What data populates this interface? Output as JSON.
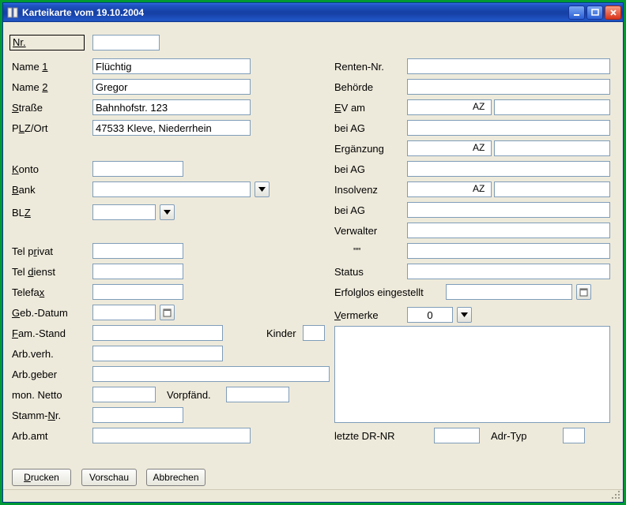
{
  "window": {
    "title": "Karteikarte vom 19.10.2004"
  },
  "labels": {
    "nr": "Nr.",
    "name1_pre": "Name ",
    "name1_u": "1",
    "name2_pre": "Name ",
    "name2_u": "2",
    "strasse_u": "S",
    "strasse_post": "traße",
    "plzort_pre": "P",
    "plzort_u": "L",
    "plzort_post": "Z/Ort",
    "konto_u": "K",
    "konto_post": "onto",
    "bank_u": "B",
    "bank_post": "ank",
    "blz_pre": "BL",
    "blz_u": "Z",
    "telpriv_pre": "Tel p",
    "telpriv_u": "r",
    "telpriv_post": "ivat",
    "teldienst_pre": "Tel ",
    "teldienst_u": "d",
    "teldienst_post": "ienst",
    "telefax_pre": "Telefa",
    "telefax_u": "x",
    "gebdatum_u": "G",
    "gebdatum_post": "eb.-Datum",
    "famstand_u": "F",
    "famstand_post": "am.-Stand",
    "arbverh": "Arb.verh.",
    "arbgeber": "Arb.geber",
    "monnetto": "mon. Netto",
    "stammnr_pre": "Stamm-",
    "stammnr_u": "N",
    "stammnr_post": "r.",
    "arbamt": "Arb.amt",
    "kinder": "Kinder",
    "vorpf": "Vorpfänd.",
    "rentennr": "Renten-Nr.",
    "behoerde": "Behörde",
    "evam_u": "E",
    "evam_post": "V am",
    "beiag": "bei AG",
    "ergaenzung": "Ergänzung",
    "insolvenz": "Insolvenz",
    "verwalter": "Verwalter",
    "quotes": "\"\"",
    "status": "Status",
    "erfolglos": "Erfolglos eingestellt",
    "vermerke_u": "V",
    "vermerke_post": "ermerke",
    "letzte": "letzte DR-NR",
    "adrtyp": "Adr-Typ",
    "az": "AZ"
  },
  "values": {
    "nr": "",
    "name1": "Flüchtig",
    "name2": "Gregor",
    "strasse": "Bahnhofstr. 123",
    "plzort": "47533 Kleve, Niederrhein",
    "konto": "",
    "bank": "",
    "blz": "",
    "telpriv": "",
    "teldienst": "",
    "telefax": "",
    "gebdatum": "",
    "famstand": "",
    "kinder": "",
    "arbverh": "",
    "arbgeber": "",
    "monnetto": "",
    "vorpf": "",
    "stammnr": "",
    "arbamt": "",
    "rentennr": "",
    "behoerde": "",
    "evam": "",
    "evam_az": "",
    "beiag1": "",
    "ergaenzung": "",
    "erg_az": "",
    "beiag2": "",
    "insolvenz": "",
    "ins_az": "",
    "beiag3": "",
    "verwalter": "",
    "verwalter2": "",
    "status": "",
    "erfolglos": "",
    "vermerke_count": "0",
    "vermerke_text": "",
    "letzte": "",
    "adrtyp": ""
  },
  "buttons": {
    "drucken": "Drucken",
    "vorschau": "Vorschau",
    "abbrechen": "Abbrechen"
  }
}
